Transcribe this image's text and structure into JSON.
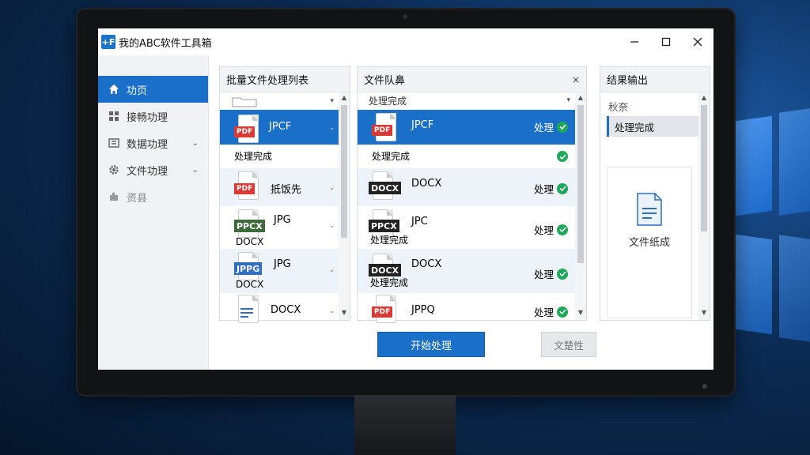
{
  "window": {
    "title": "我的ABC软件工具箱",
    "logo_text": "+F"
  },
  "sidebar": {
    "items": [
      {
        "label": "功页",
        "icon": "home-icon"
      },
      {
        "label": "接畅功理",
        "icon": "grid-icon"
      },
      {
        "label": "数据功理",
        "icon": "data-icon"
      },
      {
        "label": "文件功理",
        "icon": "gear-icon"
      },
      {
        "label": "资县",
        "icon": "puzzle-icon"
      }
    ]
  },
  "batch_panel": {
    "title": "批量文件处理列表",
    "rows": [
      {
        "tag": "PDF",
        "name": "JPCF",
        "sub": "处理完成"
      },
      {
        "tag": "PDF",
        "name": "抵饭先"
      },
      {
        "tag": "PPCX",
        "name": "JPG",
        "sub": "DOCX"
      },
      {
        "tag": "JPPG",
        "name": "JPG",
        "sub": "DOCX"
      },
      {
        "tag": "",
        "name": "DOCX"
      }
    ]
  },
  "queue_panel": {
    "title": "文件队鼻",
    "close": "×",
    "subheader": "处理完成",
    "rows": [
      {
        "tag": "PDF",
        "name": "JPCF",
        "status": "处理"
      },
      {
        "sub": "处理完成"
      },
      {
        "tag": "DOCX",
        "name": "DOCX",
        "status": "处理"
      },
      {
        "tag": "PPCX",
        "name": "JPC",
        "sub": "处理完成",
        "status": "处理"
      },
      {
        "tag": "DOCX",
        "name": "DOCX",
        "sub": "处理完成",
        "status": "处理"
      },
      {
        "tag": "PDF",
        "name": "JPPQ",
        "status": "处理"
      }
    ]
  },
  "result_panel": {
    "title": "结果输出",
    "items": [
      "秋奈",
      "处理完成"
    ],
    "card_label": "文件纸成"
  },
  "buttons": {
    "start": "开始处理",
    "secondary": "文楚性"
  },
  "colors": {
    "accent": "#1a6fc9",
    "success": "#1ea85a",
    "pdf": "#d93a35"
  }
}
